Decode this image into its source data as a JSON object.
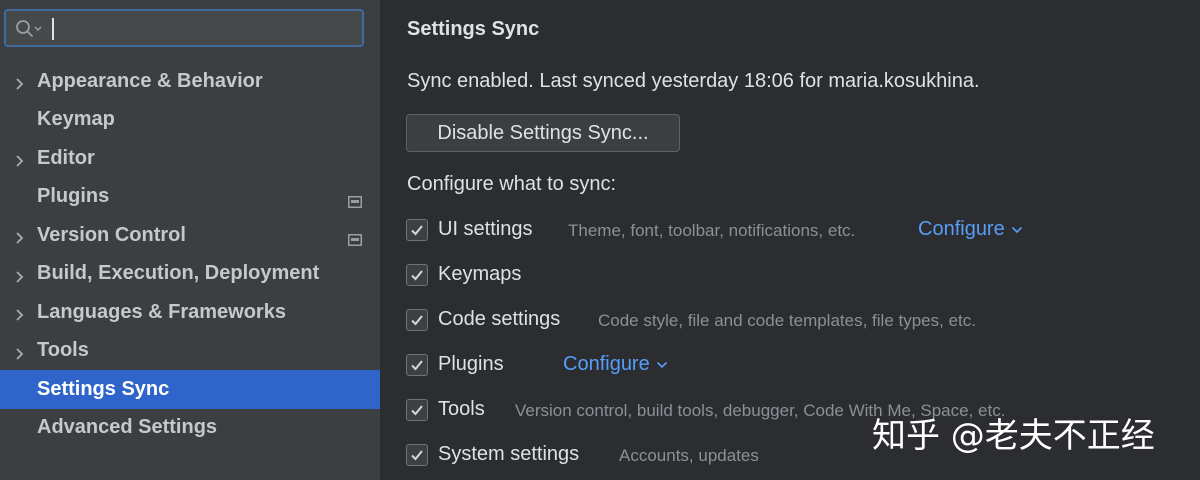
{
  "search": {
    "value": "",
    "placeholder": ""
  },
  "sidebar": {
    "items": [
      {
        "label": "Appearance & Behavior",
        "expandable": true
      },
      {
        "label": "Keymap",
        "expandable": false
      },
      {
        "label": "Editor",
        "expandable": true
      },
      {
        "label": "Plugins",
        "expandable": false,
        "badge": true
      },
      {
        "label": "Version Control",
        "expandable": true,
        "badge": true
      },
      {
        "label": "Build, Execution, Deployment",
        "expandable": true
      },
      {
        "label": "Languages & Frameworks",
        "expandable": true
      },
      {
        "label": "Tools",
        "expandable": true
      },
      {
        "label": "Settings Sync",
        "expandable": false,
        "selected": true
      },
      {
        "label": "Advanced Settings",
        "expandable": false
      }
    ]
  },
  "main": {
    "title": "Settings Sync",
    "status": "Sync enabled. Last synced yesterday 18:06 for maria.kosukhina.",
    "disable_button": "Disable Settings Sync...",
    "configure_prompt": "Configure what to sync:",
    "options": [
      {
        "name": "UI settings",
        "checked": true,
        "description": "Theme, font, toolbar, notifications, etc.",
        "link": "Configure"
      },
      {
        "name": "Keymaps",
        "checked": true
      },
      {
        "name": "Code settings",
        "checked": true,
        "description": "Code style, file and code templates, file types, etc."
      },
      {
        "name": "Plugins",
        "checked": true,
        "link": "Configure"
      },
      {
        "name": "Tools",
        "checked": true,
        "description": "Version control, build tools, debugger, Code With Me, Space, etc."
      },
      {
        "name": "System settings",
        "checked": true,
        "description": "Accounts, updates"
      }
    ]
  },
  "watermark": "知乎 @老夫不正经",
  "colors": {
    "sidebar_bg": "#3c3f41",
    "main_bg": "#2b2d30",
    "selection": "#2f65ca",
    "link": "#589df6",
    "muted_text": "#8c9096"
  },
  "icons": {
    "search": "search-icon",
    "expand": "chevron-right-icon",
    "badge": "settings-badge-icon",
    "check": "checkmark-icon",
    "dropdown": "chevron-down-icon"
  }
}
